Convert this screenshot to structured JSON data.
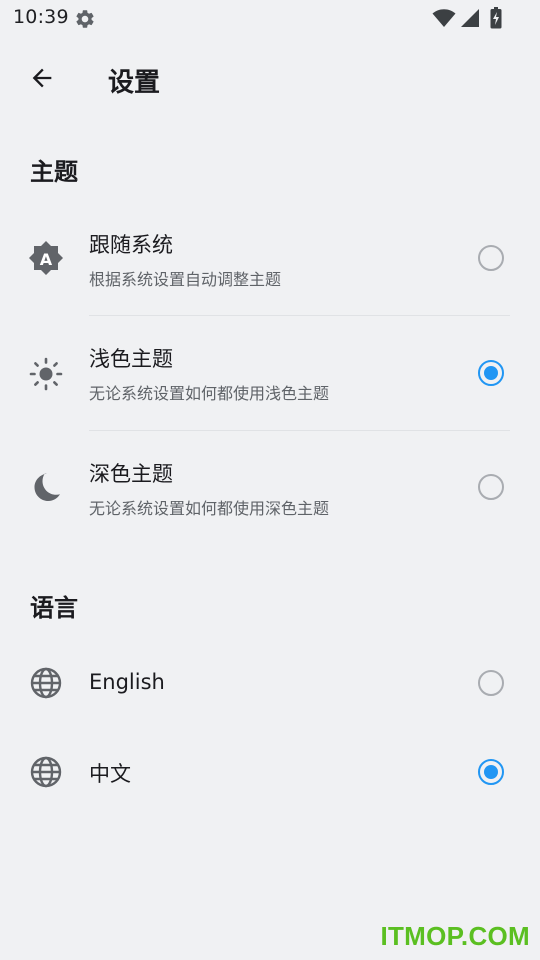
{
  "status_bar": {
    "time": "10:39",
    "icons": [
      "gear-icon",
      "wifi-icon",
      "signal-icon",
      "battery-charging-icon"
    ]
  },
  "app_bar": {
    "title": "设置",
    "back_icon": "arrow-back-icon"
  },
  "theme_section": {
    "header": "主题",
    "options": [
      {
        "icon": "auto-brightness-icon",
        "title": "跟随系统",
        "subtitle": "根据系统设置自动调整主题",
        "selected": false
      },
      {
        "icon": "sun-icon",
        "title": "浅色主题",
        "subtitle": "无论系统设置如何都使用浅色主题",
        "selected": true
      },
      {
        "icon": "moon-icon",
        "title": "深色主题",
        "subtitle": "无论系统设置如何都使用深色主题",
        "selected": false
      }
    ]
  },
  "language_section": {
    "header": "语言",
    "options": [
      {
        "icon": "globe-icon",
        "title": "English",
        "selected": false
      },
      {
        "icon": "globe-icon",
        "title": "中文",
        "selected": true
      }
    ]
  },
  "colors": {
    "accent": "#2196f3",
    "background": "#f0f1f3",
    "watermark": "#5bbf21"
  },
  "watermark": "ITMOP.COM"
}
